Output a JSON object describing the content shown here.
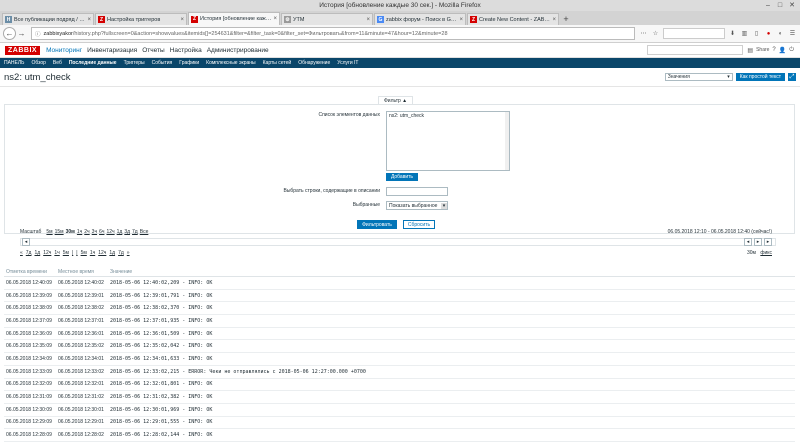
{
  "window": {
    "title": "История [обновление каждые 30 сек.] - Mozilla Firefox"
  },
  "tabs": [
    {
      "label": "Все публикации подряд / Ha...",
      "color": "#6b8da6",
      "glyph": "H"
    },
    {
      "label": "Настройка триггеров",
      "color": "#d40000",
      "glyph": "Z"
    },
    {
      "label": "История [обновление кажд...",
      "color": "#d40000",
      "glyph": "Z",
      "active": true
    },
    {
      "label": "УТМ",
      "color": "#999999",
      "glyph": "⚙"
    },
    {
      "label": "zabbix форум - Поиск в Goo...",
      "color": "#4a8af4",
      "glyph": "G"
    },
    {
      "label": "Create New Content - ZABBIX...",
      "color": "#d40000",
      "glyph": "Z"
    }
  ],
  "nav": {
    "url_host": "zabbixyakor",
    "url_rest": "/history.php?fullscreen=0&action=showvalues&itemids[]=254631&filter=&filter_task=0&filter_set=Фильтровать&from=11&minute=47&hour=12&minute=28"
  },
  "zabbix": {
    "logo": "ZABBIX",
    "menu": [
      "Мониторинг",
      "Инвентаризация",
      "Отчеты",
      "Настройка",
      "Администрирование"
    ],
    "submenu": [
      "ПАНЕЛЬ",
      "Обзор",
      "Веб",
      "Последние данные",
      "Триггеры",
      "События",
      "Графики",
      "Комплексные экраны",
      "Карты сетей",
      "Обнаружение",
      "Услуги IT"
    ]
  },
  "page": {
    "title": "ns2: utm_check",
    "view_select": "Значения",
    "plain_text_btn": "Как простой текст",
    "fullscreen": "⤢"
  },
  "filter": {
    "tab_label": "Фильтр ▲",
    "items_label": "Список элементов данных",
    "items_value": "ns2: utm_check",
    "add_btn": "Добавить",
    "desc_label": "Выбрать строки, содержащие в описании",
    "selected_label": "Выбранные",
    "selected_value": "Показать выбранное",
    "apply_btn": "Фильтровать",
    "reset_btn": "Сбросить"
  },
  "time": {
    "zoom_label": "Масштаб",
    "zooms": [
      "5м",
      "15м",
      "30м",
      "1ч",
      "2ч",
      "3ч",
      "6ч",
      "12ч",
      "1д",
      "3д",
      "7д",
      "Все"
    ],
    "active_zoom": "30м",
    "period": "06.05.2018 12:10 - 06.05.2018 12:40 (сейчас!)",
    "nav_back": [
      "«",
      "7д",
      "1д",
      "12ч",
      "1ч",
      "5м",
      "|"
    ],
    "nav_fwd": [
      "|",
      "5м",
      "1ч",
      "12ч",
      "1д",
      "7д",
      "»"
    ],
    "zoom_value": "30м",
    "fixed_label": "фикс"
  },
  "table": {
    "headers": [
      "Отметка времени",
      "Местное время",
      "Значение"
    ],
    "rows": [
      [
        "06.05.2018 12:40:09",
        "06.05.2018 12:40:02",
        "2018-05-06 12:40:02,209 - INFO: OK"
      ],
      [
        "06.05.2018 12:39:09",
        "06.05.2018 12:39:01",
        "2018-05-06 12:39:01,791 - INFO: OK"
      ],
      [
        "06.05.2018 12:38:09",
        "06.05.2018 12:38:02",
        "2018-05-06 12:38:02,370 - INFO: OK"
      ],
      [
        "06.05.2018 12:37:09",
        "06.05.2018 12:37:01",
        "2018-05-06 12:37:01,935 - INFO: OK"
      ],
      [
        "06.05.2018 12:36:09",
        "06.05.2018 12:36:01",
        "2018-05-06 12:36:01,509 - INFO: OK"
      ],
      [
        "06.05.2018 12:35:09",
        "06.05.2018 12:35:02",
        "2018-05-06 12:35:02,042 - INFO: OK"
      ],
      [
        "06.05.2018 12:34:09",
        "06.05.2018 12:34:01",
        "2018-05-06 12:34:01,633 - INFO: OK"
      ],
      [
        "06.05.2018 12:33:09",
        "06.05.2018 12:33:02",
        "2018-05-06 12:33:02,215 - ERROR: Чеки не отправлялись с 2018-05-06 12:27:00.000 +0700"
      ],
      [
        "06.05.2018 12:32:09",
        "06.05.2018 12:32:01",
        "2018-05-06 12:32:01,801 - INFO: OK"
      ],
      [
        "06.05.2018 12:31:09",
        "06.05.2018 12:31:02",
        "2018-05-06 12:31:02,382 - INFO: OK"
      ],
      [
        "06.05.2018 12:30:09",
        "06.05.2018 12:30:01",
        "2018-05-06 12:30:01,969 - INFO: OK"
      ],
      [
        "06.05.2018 12:29:09",
        "06.05.2018 12:29:01",
        "2018-05-06 12:29:01,555 - INFO: OK"
      ],
      [
        "06.05.2018 12:28:09",
        "06.05.2018 12:28:02",
        "2018-05-06 12:28:02,144 - INFO: OK"
      ]
    ]
  }
}
